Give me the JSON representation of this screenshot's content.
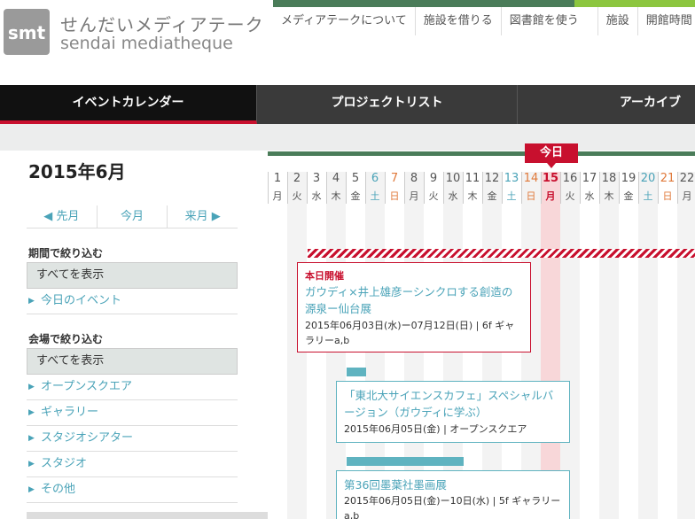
{
  "logo": {
    "mark": "smt",
    "jp": "せんだいメディアテーク",
    "en": "sendai mediatheque"
  },
  "top_nav": [
    "メディアテークについて",
    "施設を借りる",
    "図書館を使う",
    "施設",
    "開館時間"
  ],
  "main_nav": [
    {
      "label": "イベントカレンダー",
      "active": true
    },
    {
      "label": "プロジェクトリスト",
      "active": false
    },
    {
      "label": "アーカイブ",
      "active": false
    }
  ],
  "month_title": "2015年6月",
  "month_nav": {
    "prev": "先月",
    "current": "今月",
    "next": "来月"
  },
  "period_filter": {
    "heading": "期間で絞り込む",
    "show_all": "すべてを表示",
    "items": [
      "今日のイベント"
    ]
  },
  "venue_filter": {
    "heading": "会場で絞り込む",
    "show_all": "すべてを表示",
    "items": [
      "オープンスクエア",
      "ギャラリー",
      "スタジオシアター",
      "スタジオ",
      "その他"
    ]
  },
  "calendar": {
    "today_label": "今日",
    "today": 15,
    "days": [
      {
        "num": "1",
        "wk": "月",
        "type": "weekday"
      },
      {
        "num": "2",
        "wk": "火",
        "type": "weekday"
      },
      {
        "num": "3",
        "wk": "水",
        "type": "weekday"
      },
      {
        "num": "4",
        "wk": "木",
        "type": "weekday"
      },
      {
        "num": "5",
        "wk": "金",
        "type": "weekday"
      },
      {
        "num": "6",
        "wk": "土",
        "type": "sat"
      },
      {
        "num": "7",
        "wk": "日",
        "type": "sun"
      },
      {
        "num": "8",
        "wk": "月",
        "type": "weekday"
      },
      {
        "num": "9",
        "wk": "火",
        "type": "weekday"
      },
      {
        "num": "10",
        "wk": "水",
        "type": "weekday"
      },
      {
        "num": "11",
        "wk": "木",
        "type": "weekday"
      },
      {
        "num": "12",
        "wk": "金",
        "type": "weekday"
      },
      {
        "num": "13",
        "wk": "土",
        "type": "sat"
      },
      {
        "num": "14",
        "wk": "日",
        "type": "sun"
      },
      {
        "num": "15",
        "wk": "月",
        "type": "today"
      },
      {
        "num": "16",
        "wk": "火",
        "type": "weekday"
      },
      {
        "num": "17",
        "wk": "水",
        "type": "weekday"
      },
      {
        "num": "18",
        "wk": "木",
        "type": "weekday"
      },
      {
        "num": "19",
        "wk": "金",
        "type": "weekday"
      },
      {
        "num": "20",
        "wk": "土",
        "type": "sat"
      },
      {
        "num": "21",
        "wk": "日",
        "type": "sun"
      },
      {
        "num": "22",
        "wk": "月",
        "type": "weekday"
      }
    ]
  },
  "events": [
    {
      "badge": "本日開催",
      "title": "ガウディ×井上雄彦ーシンクロする創造の源泉ー仙台展",
      "meta": "2015年06月03日(水)ー07月12日(日) | 6f ギャラリーa,b"
    },
    {
      "badge": "",
      "title": "「東北大サイエンスカフェ」スペシャルバージョン（ガウディに学ぶ）",
      "meta": "2015年06月05日(金) | オープンスクエア"
    },
    {
      "badge": "",
      "title": "第36回墨葉社墨画展",
      "meta": "2015年06月05日(金)ー10日(水) | 5f ギャラリーa,b"
    }
  ],
  "colors": {
    "accent_red": "#c8102e",
    "teal": "#4aa3b8",
    "green": "#4a7c59",
    "sat_blue": "#4aa3b8",
    "sun_orange": "#e0793a"
  }
}
